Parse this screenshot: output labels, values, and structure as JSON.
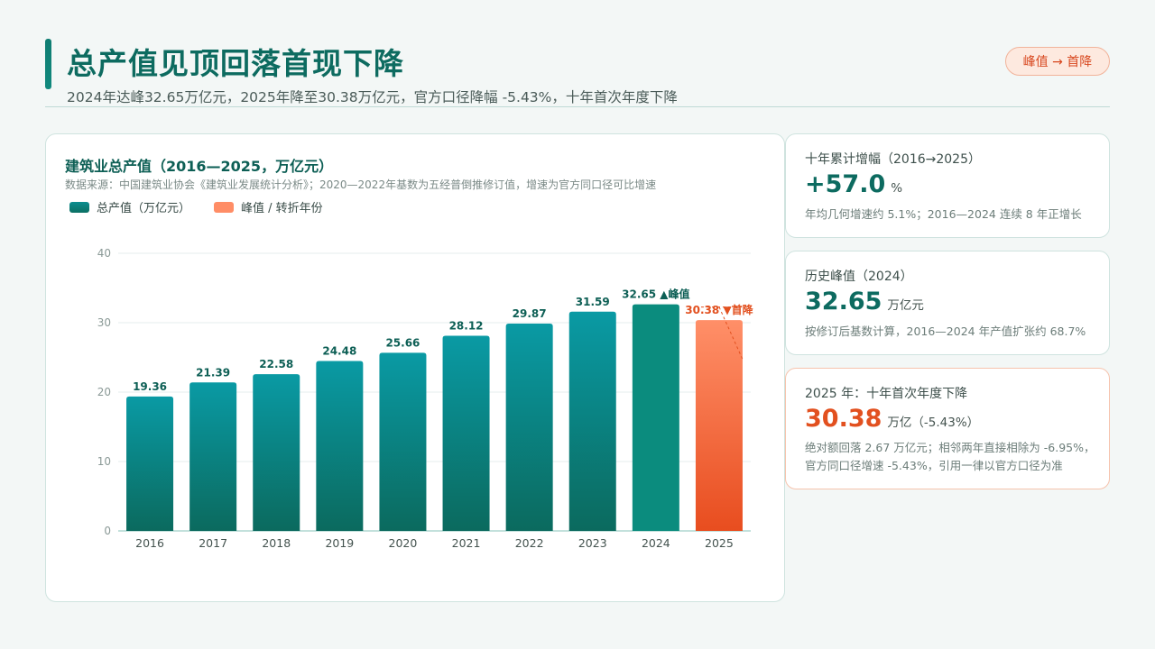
{
  "header": {
    "title": "总产值见顶回落首现下降",
    "subtitle": "2024年达峰32.65万亿元，2025年降至30.38万亿元，官方口径降幅 -5.43%，十年首次年度下降",
    "badge": "峰值 → 首降"
  },
  "chart_card": {
    "title": "建筑业总产值（2016—2025，万亿元）",
    "source": "数据来源：中国建筑业协会《建筑业发展统计分析》；2020—2022年基数为五经普倒推修订值，增速为官方同口径可比增速",
    "legend": [
      {
        "label": "总产值（万亿元）",
        "swatch": "teal"
      },
      {
        "label": "峰值 / 转折年份",
        "swatch": "orange"
      }
    ]
  },
  "chart_data": {
    "type": "bar",
    "title": "建筑业总产值（2016—2025，万亿元）",
    "categories": [
      "2016",
      "2017",
      "2018",
      "2019",
      "2020",
      "2021",
      "2022",
      "2023",
      "2024",
      "2025"
    ],
    "series": [
      {
        "name": "总产值（万亿元）",
        "values": [
          19.36,
          21.39,
          22.58,
          24.48,
          25.66,
          28.12,
          29.87,
          31.59,
          32.65,
          30.38
        ]
      }
    ],
    "ylim": [
      0,
      40
    ],
    "yticks": [
      0,
      10,
      20,
      30,
      40
    ],
    "grid": true,
    "annotations": [
      {
        "category": "2024",
        "text": "▲峰值"
      },
      {
        "category": "2025",
        "text": "▼首降"
      }
    ],
    "colors": {
      "bar_top": "#0a9aa4",
      "bar_bottom": "#0b6a5e",
      "peak": "#0b8c7e",
      "drop_top": "#ff8f68",
      "drop_bottom": "#e84d1f",
      "label": "#0d5f55",
      "drop_label": "#e2501f"
    }
  },
  "kpis": [
    {
      "label": "十年累计增幅（2016→2025）",
      "value": "+57.0",
      "unit": "%",
      "note": "年均几何增速约 5.1%；2016—2024 连续 8 年正增长"
    },
    {
      "label": "历史峰值（2024）",
      "value": "32.65",
      "unit": "万亿元",
      "note": "按修订后基数计算，2016—2024 年产值扩张约 68.7%"
    },
    {
      "label": "2025 年：十年首次年度下降",
      "value": "30.38",
      "unit": "万亿（-5.43%）",
      "note_lines": [
        "绝对额回落 2.67 万亿元；相邻两年直接相除为 -6.95%，",
        "官方同口径增速 -5.43%，引用一律以官方口径为准"
      ]
    }
  ]
}
